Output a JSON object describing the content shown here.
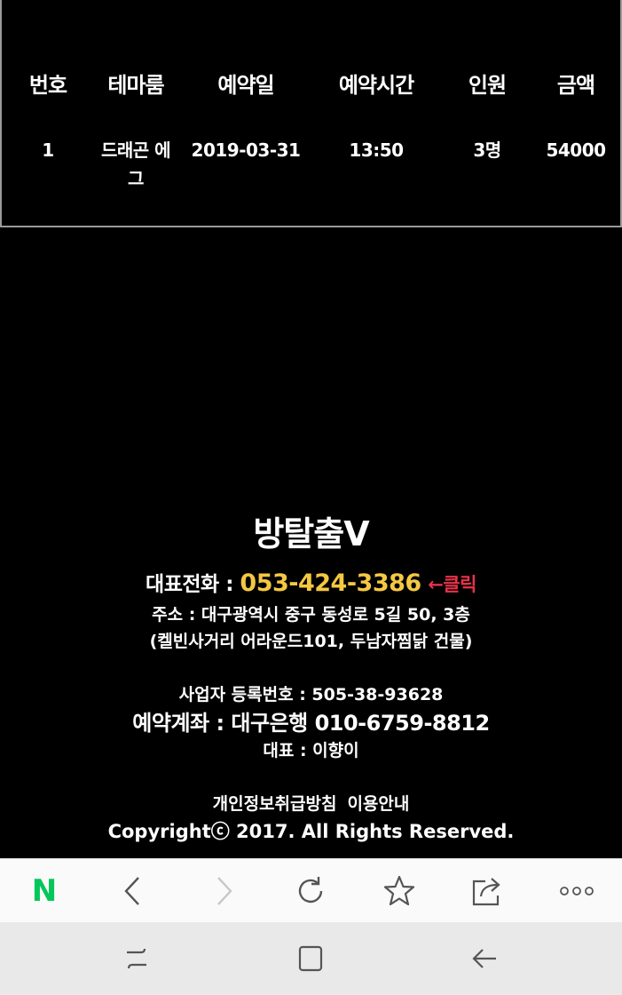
{
  "table": {
    "headers": [
      "번호",
      "테마룸",
      "예약일",
      "예약시간",
      "인원",
      "금액"
    ],
    "row": {
      "no": "1",
      "theme_line1": "드래곤 에",
      "theme_line2": "그",
      "date": "2019-03-31",
      "time": "13:50",
      "people": "3명",
      "price": "54000"
    }
  },
  "footer": {
    "brand": "방탈출V",
    "phone_label": "대표전화 : ",
    "phone": "053-424-3386",
    "click_hint": "←클릭",
    "address1": "주소 : 대구광역시 중구 동성로 5길 50, 3층",
    "address2": "(켈빈사거리 어라운드101, 두남자찜닭 건물)",
    "business_no": "사업자 등록번호 : 505-38-93628",
    "account": "예약계좌 : 대구은행 010-6759-8812",
    "representative": "대표 : 이향이",
    "privacy_link": "개인정보취급방침",
    "terms_link": "이용안내",
    "copyright": "Copyrightⓒ 2017. All Rights Reserved."
  },
  "toolbar": {
    "icons": [
      "naver-home-icon",
      "back-icon",
      "forward-icon",
      "refresh-icon",
      "bookmark-star-icon",
      "share-icon",
      "more-icon"
    ],
    "naver_logo": "N",
    "accent": "#03c75a",
    "disabled": "#c8c8c8"
  },
  "navbar": {
    "icons": [
      "recent-apps-icon",
      "home-icon",
      "back-icon"
    ]
  }
}
